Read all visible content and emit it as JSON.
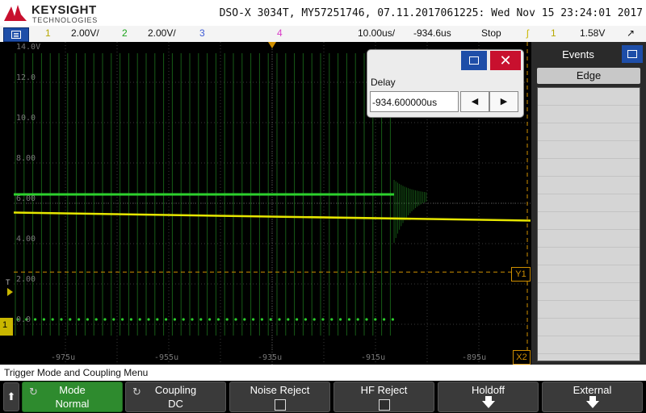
{
  "header": {
    "brand": "KEYSIGHT",
    "brand_sub": "TECHNOLOGIES",
    "instrument_line": "DSO-X 3034T, MY57251746, 07.11.2017061225: Wed Nov 15 23:24:01 2017"
  },
  "status": {
    "ch1_num": "1",
    "ch1_scale": "2.00V/",
    "ch2_num": "2",
    "ch2_scale": "2.00V/",
    "ch3_num": "3",
    "ch4_num": "4",
    "timebase": "10.00us/",
    "delay": "-934.6us",
    "run_state": "Stop",
    "trig_icon": "ʃ",
    "trig_source": "1",
    "trig_level": "1.58V",
    "trig_slope_icon": "↗"
  },
  "grid": {
    "y_labels": [
      "14.0V",
      "12.0",
      "10.0",
      "8.00",
      "6.00",
      "4.00",
      "2.00",
      "0.0"
    ],
    "x_labels": [
      "-975u",
      "-955u",
      "-935u",
      "-915u",
      "-895u"
    ],
    "t_marker": "T",
    "ground_marker": "1",
    "y1_tag": "Y1",
    "x2_tag": "X2"
  },
  "delay_dialog": {
    "label": "Delay",
    "value": "-934.600000us",
    "prev": "◀",
    "next": "▶",
    "close": "✕"
  },
  "sidebar": {
    "title": "Events",
    "edge_label": "Edge"
  },
  "menu": {
    "title": "Trigger Mode and Coupling Menu",
    "back": "⬆",
    "mode_label": "Mode",
    "mode_value": "Normal",
    "coupling_label": "Coupling",
    "coupling_value": "DC",
    "noise_reject_label": "Noise Reject",
    "hf_reject_label": "HF Reject",
    "holdoff_label": "Holdoff",
    "external_label": "External",
    "cycle_icon": "↻"
  },
  "colors": {
    "ch1": "#e6e600",
    "ch2": "#2dd12d",
    "cursor": "#d08f00",
    "menu_blue": "#1e4ea8",
    "close_red": "#c8102e"
  },
  "scope_data": {
    "ch1_level_start_v": 5.3,
    "ch1_level_end_v": 4.9,
    "ch2_high_v": 6.2,
    "ch2_low_v": 0.0,
    "ch2_stop_time_us": -911,
    "cursor_y1_v": 2.35
  }
}
